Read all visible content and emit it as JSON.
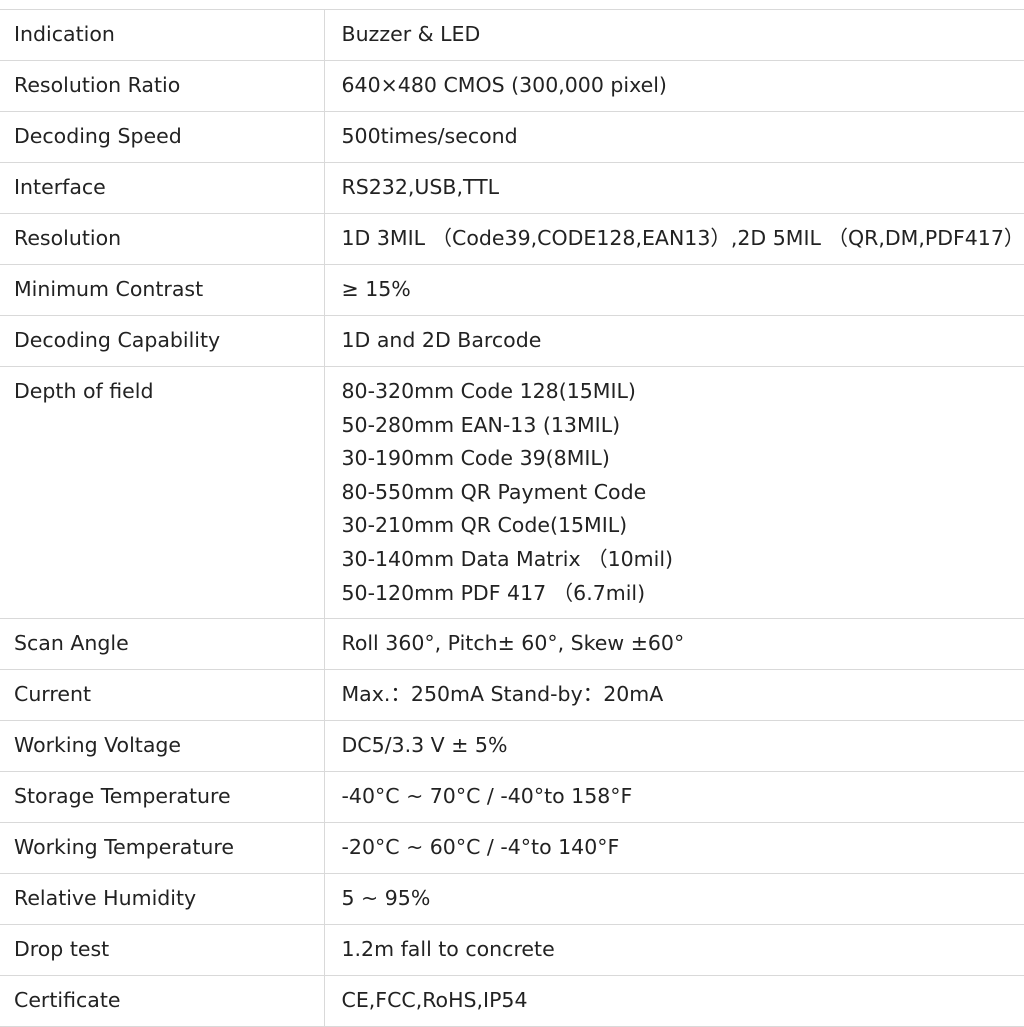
{
  "rows": [
    {
      "label": "Indication",
      "value": "Buzzer & LED"
    },
    {
      "label": "Resolution Ratio",
      "value": "640×480 CMOS (300,000 pixel)"
    },
    {
      "label": "Decoding Speed",
      "value": "500times/second"
    },
    {
      "label": "Interface",
      "value": "RS232,USB,TTL"
    },
    {
      "label": "Resolution",
      "value": "1D 3MIL （Code39,CODE128,EAN13）,2D 5MIL （QR,DM,PDF417）"
    },
    {
      "label": "Minimum Contrast",
      "value": "≥ 15%"
    },
    {
      "label": "Decoding Capability",
      "value": "1D and 2D Barcode"
    },
    {
      "label": "Depth of field",
      "lines": [
        "80-320mm Code 128(15MIL)",
        "50-280mm EAN-13 (13MIL)",
        "30-190mm Code 39(8MIL)",
        "80-550mm QR Payment Code",
        "30-210mm QR Code(15MIL)",
        "30-140mm Data Matrix （10mil)",
        "50-120mm PDF 417 （6.7mil)"
      ]
    },
    {
      "label": "Scan Angle",
      "value": "Roll 360°, Pitch± 60°, Skew ±60°"
    },
    {
      "label": "Current",
      "value": "Max.：250mA Stand-by：20mA"
    },
    {
      "label": "Working Voltage",
      "value": "DC5/3.3 V ± 5%"
    },
    {
      "label": "Storage Temperature",
      "value": "-40°C ~ 70°C / -40°to 158°F"
    },
    {
      "label": "Working Temperature",
      "value": "-20°C ~ 60°C / -4°to 140°F"
    },
    {
      "label": "Relative Humidity",
      "value": "5 ~ 95%"
    },
    {
      "label": "Drop test",
      "value": "1.2m fall to concrete"
    },
    {
      "label": "Certificate",
      "value": "CE,FCC,RoHS,IP54"
    }
  ]
}
